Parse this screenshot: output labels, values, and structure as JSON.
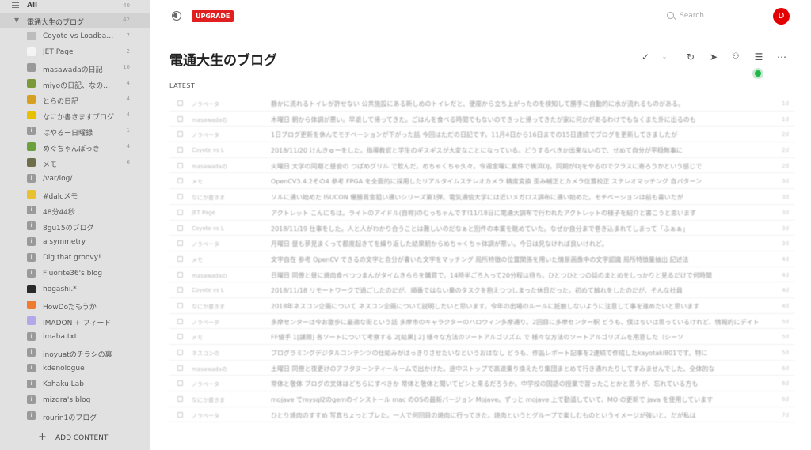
{
  "sidebar": {
    "all": {
      "label": "All",
      "count": "40"
    },
    "folder": {
      "label": "電通大生のブログ",
      "count": "42"
    },
    "feeds": [
      {
        "label": "Coyote vs Loadba…",
        "count": "7",
        "icon_color": "#bcbcbc",
        "icon_glyph": ""
      },
      {
        "label": "JET Page",
        "count": "2",
        "icon_color": "#f4f4f4",
        "icon_glyph": ""
      },
      {
        "label": "masawadaの日記",
        "count": "10",
        "icon_color": "#9a9a9a",
        "icon_glyph": ""
      },
      {
        "label": "miyoの日記、なの…",
        "count": "4",
        "icon_color": "#7a9a3a",
        "icon_glyph": ""
      },
      {
        "label": "とらの日記",
        "count": "4",
        "icon_color": "#d8a020",
        "icon_glyph": ""
      },
      {
        "label": "なにか書きますブログ",
        "count": "4",
        "icon_color": "#e8c000",
        "icon_glyph": ""
      },
      {
        "label": "はやるー日曜録",
        "count": "1",
        "icon_color": "#9a9a9a",
        "icon_glyph": "i"
      },
      {
        "label": "めぐちゃんぽっき",
        "count": "4",
        "icon_color": "#6aa040",
        "icon_glyph": ""
      },
      {
        "label": "メモ",
        "count": "6",
        "icon_color": "#6e6e4a",
        "icon_glyph": ""
      },
      {
        "label": "/var/log/",
        "count": "",
        "icon_color": "#9a9a9a",
        "icon_glyph": "i"
      },
      {
        "label": "#dalcメモ",
        "count": "",
        "icon_color": "#e8c030",
        "icon_glyph": ""
      },
      {
        "label": "48分44秒",
        "count": "",
        "icon_color": "#9a9a9a",
        "icon_glyph": "i"
      },
      {
        "label": "8gu15のブログ",
        "count": "",
        "icon_color": "#9a9a9a",
        "icon_glyph": "i"
      },
      {
        "label": "a symmetry",
        "count": "",
        "icon_color": "#9a9a9a",
        "icon_glyph": "i"
      },
      {
        "label": "Dig that groovy!",
        "count": "",
        "icon_color": "#9a9a9a",
        "icon_glyph": "i"
      },
      {
        "label": "Fluorite36's blog",
        "count": "",
        "icon_color": "#9a9a9a",
        "icon_glyph": "i"
      },
      {
        "label": "hogashi.*",
        "count": "",
        "icon_color": "#2a2a2a",
        "icon_glyph": ""
      },
      {
        "label": "HowDoだもうか",
        "count": "",
        "icon_color": "#f07a30",
        "icon_glyph": ""
      },
      {
        "label": "IMADON + フィード",
        "count": "",
        "icon_color": "#b0a8e8",
        "icon_glyph": ""
      },
      {
        "label": "imaha.txt",
        "count": "",
        "icon_color": "#9a9a9a",
        "icon_glyph": "i"
      },
      {
        "label": "inoyuatのチラシの裏",
        "count": "",
        "icon_color": "#9a9a9a",
        "icon_glyph": "i"
      },
      {
        "label": "kdenologue",
        "count": "",
        "icon_color": "#9a9a9a",
        "icon_glyph": "i"
      },
      {
        "label": "Kohaku Lab",
        "count": "",
        "icon_color": "#9a9a9a",
        "icon_glyph": "i"
      },
      {
        "label": "mizdra's blog",
        "count": "",
        "icon_color": "#9a9a9a",
        "icon_glyph": "i"
      },
      {
        "label": "rourin1のブログ",
        "count": "",
        "icon_color": "#9a9a9a",
        "icon_glyph": "i"
      }
    ],
    "add_content_label": "ADD CONTENT"
  },
  "header": {
    "upgrade_label": "UPGRADE",
    "search_placeholder": "Search",
    "avatar_initial": "D"
  },
  "main": {
    "title": "電通大生のブログ",
    "section_label": "LATEST"
  },
  "colors": {
    "accent_red": "#e02020",
    "sidebar_bg": "#e1e1e1",
    "status_green": "#1fb84a"
  },
  "entries": [
    {
      "feed": "ノラベータ",
      "text": "静かに流れるトイレが許せない 公共施設にある新しめのトイレだと、便座から立ち上がったのを検知して勝手に自動的に水が流れるものがある。",
      "time": "1d"
    },
    {
      "feed": "masawadaの",
      "text": "木曜日 朝から体調が悪い。早退して帰ってきた。ごはんを食べる時間でもないのできっと帰ってきたが家に何かがあるわけでもなくまた外に出るのも",
      "time": "1d"
    },
    {
      "feed": "ノラベータ",
      "text": "1日ブログ更新を休んでモチベーションが下がった話 今回はただの日記です。11月4日から16日までの15日連続でブログを更新してきましたが",
      "time": "2d"
    },
    {
      "feed": "Coyote vs L",
      "text": "2018/11/20 けんきゅーをした。指導教官と学生のギスギスが大変なことになっている。どうするべきか出来ないので、せめて自分が平穏無事に",
      "time": "2d"
    },
    {
      "feed": "masawadaの",
      "text": "火曜日 大学の同期と昼会の つばめグリル で飲んだ。めちゃくちゃ久々。今週金曜に案件で横浜DJ。同期がDJをやるのでクラスに寄ろうかという感じで",
      "time": "2d"
    },
    {
      "feed": "メモ",
      "text": "OpenCV3.4.2その4 参考 FPGA を全面的に採用したリアルタイムステレオカメラ 精度変換 歪み補正とカメラ位置校正 ステレオマッチング 自パターン",
      "time": "3d"
    },
    {
      "feed": "なにか書きま",
      "text": "ソルに通い始めた ISUCON 優勝賞金狙い通いシリーズ第1弾。電気通信大学には近いメガロス調布に通い始めた。モチベーションは前も書いたが",
      "time": "3d"
    },
    {
      "feed": "JET Page",
      "text": "アクトレット こんにちは。ライトのアイドル(自称)のむっちゃんです!11/18日に電通大調布で行われたアクトレットの様子を紹介と書こうと思います",
      "time": "3d"
    },
    {
      "feed": "Coyote vs L",
      "text": "2018/11/19 仕事をした。人と人がわかり合うことは難しいのだなぁと別件の本業を眺めていた。なぜか自分まで巻き込まれてしまって「ふぁぁ」",
      "time": "3d"
    },
    {
      "feed": "ノラベータ",
      "text": "月曜日 昼も夢見まくって都度起きてを繰り返した結果朝からめちゃくちゃ体調が悪い。今日は見なければ良いけれど。",
      "time": "3d"
    },
    {
      "feed": "メモ",
      "text": "文字自在 参考 OpenCV できるの文字と自分が書いた文字をマッチング 局所特徴の位置関係を用いた情景画像中の文字認識 局所特徴量抽出 記述法",
      "time": "4d"
    },
    {
      "feed": "masawadaの",
      "text": "日曜日 同僚と昼に焼肉食べつつまんがタイムきららを購買で。14時半ごろ入って20分程は待ち。ひとつひとつの話のまとめをしっかりと見るだけで何時間",
      "time": "4d"
    },
    {
      "feed": "Coyote vs L",
      "text": "2018/11/18 リモートワークで過ごしたのだが、順番ではない量のタスクを抱えつつしまった休日だった。初めて触れをしたのだが、そんな社員",
      "time": "4d"
    },
    {
      "feed": "なにか書きま",
      "text": "2018年ネスコン企画について ネスコン企画について説明したいと思います。今年の出場のルールに抵触しないように注意して事を進めたいと思います",
      "time": "4d"
    },
    {
      "feed": "ノラベータ",
      "text": "多摩センターは今お散歩に最適な街という話 多摩市のキャラクターのハロウィン多摩通り。2回目に多摩センター駅 どうも、僕はちいは思っているけれど、情報的にデイト",
      "time": "5d"
    },
    {
      "feed": "メモ",
      "text": "FF値手 1[課題] 各ソートについて考察する 2[結果] 2] 様々な方法のソートアルゴリズム で 様々な方法のソートアルゴリズムを用意した（シーソ",
      "time": "5d"
    },
    {
      "feed": "ネスコンの",
      "text": "プログラミングデジタルコンテンツの仕組みがはっきりさせたいなというおはなし どうも、作品レポート記事を2連続で作成したkayotaki801です。特に",
      "time": "5d"
    },
    {
      "feed": "masawadaの",
      "text": "土曜日 同僚と夜更けのアフタヌーンティールームで出かけた。途中ストップで高速乗り換えたり集団まとめて行き通れたりしてすみませんでした、全体的な",
      "time": "6d"
    },
    {
      "feed": "ノラベータ",
      "text": "常体と敬体 ブログの文体はどちらにすべきか 常体と敬体と聞いてピンと来るだろうか。中学校の国語の授業で習ったことかと思うが、忘れている方も",
      "time": "6d"
    },
    {
      "feed": "なにか書きま",
      "text": "mojave でmysql2のgemのインストール mac のOSの最新バージョン Mojave。ずっと mojave 上で勤道していて、MO の更新で java を使用しています",
      "time": "6d"
    },
    {
      "feed": "ノラベータ",
      "text": "ひとり焼肉のすすめ 写真ちょっとブレた。一人で何回目の焼肉に行ってきた。焼肉というとグループで楽しむものというイメージが強いと、だが私は",
      "time": "7d"
    }
  ]
}
